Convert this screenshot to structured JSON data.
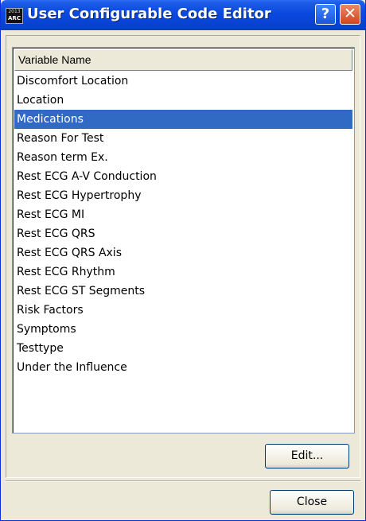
{
  "window": {
    "title": "User Configurable Code Editor",
    "icon_top": "2013",
    "icon_text": "ARC",
    "help_label": "?",
    "close_label": "✕"
  },
  "list": {
    "header": "Variable Name",
    "selected_index": 2,
    "items": [
      "Discomfort Location",
      "Location",
      "Medications",
      "Reason For Test",
      "Reason term Ex.",
      "Rest ECG A-V Conduction",
      "Rest ECG Hypertrophy",
      "Rest ECG MI",
      "Rest ECG QRS",
      "Rest ECG QRS Axis",
      "Rest ECG Rhythm",
      "Rest ECG ST Segments",
      "Risk Factors",
      "Symptoms",
      "Testtype",
      "Under the Influence"
    ]
  },
  "buttons": {
    "edit": "Edit...",
    "close": "Close"
  },
  "colors": {
    "selection": "#316ac5",
    "titlebar": "#0a48e0",
    "dialog_bg": "#ece9d8"
  }
}
